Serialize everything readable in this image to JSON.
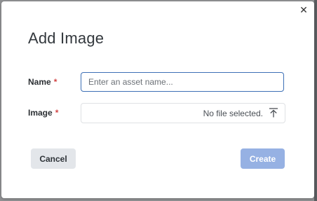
{
  "dialog": {
    "title": "Add Image",
    "close_icon": "close-icon"
  },
  "form": {
    "name": {
      "label": "Name",
      "required_mark": "*",
      "placeholder": "Enter an asset name...",
      "value": ""
    },
    "image": {
      "label": "Image",
      "required_mark": "*",
      "status": "No file selected.",
      "icon": "upload-icon"
    }
  },
  "buttons": {
    "cancel_label": "Cancel",
    "create_label": "Create"
  },
  "colors": {
    "primary_disabled": "#96b1e3",
    "focus_border": "#3d6fb6",
    "required": "#d24545"
  }
}
